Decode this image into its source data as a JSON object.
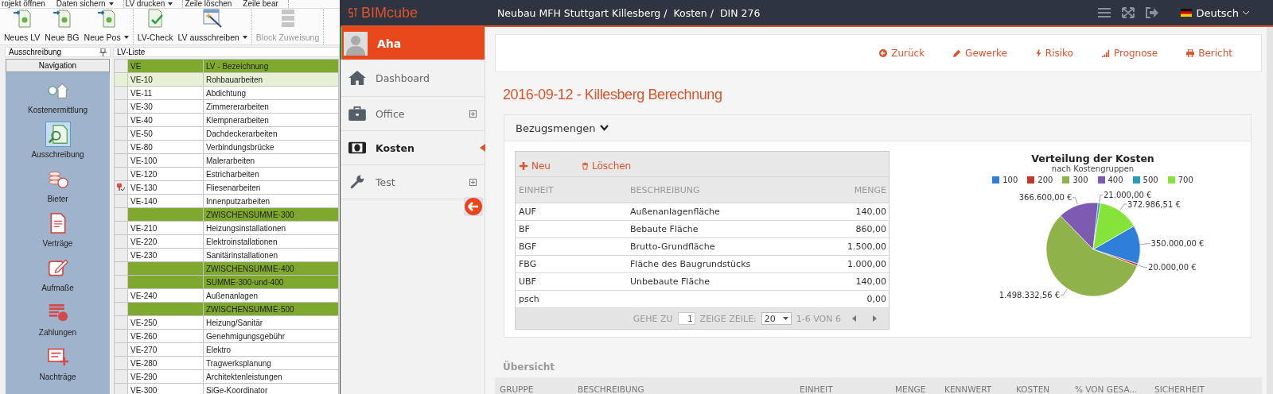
{
  "desktop_app": {
    "menu": [
      {
        "items": [
          {
            "label": "rojekt öffnen",
            "dropdown": false
          },
          {
            "label": "Daten sichern",
            "dropdown": true
          }
        ]
      },
      {
        "items": [
          {
            "label": "LV drucken",
            "dropdown": true
          }
        ]
      },
      {
        "items": [
          {
            "label": "Zeile löschen",
            "dropdown": false
          },
          {
            "label": "Zeile bear",
            "dropdown": false
          }
        ]
      }
    ],
    "toolbar": [
      {
        "buttons": [
          {
            "label": "Neues LV",
            "dropdown": false,
            "disabled": false
          },
          {
            "label": "Neue BG",
            "dropdown": false,
            "disabled": false
          },
          {
            "label": "Neue Pos",
            "dropdown": true,
            "disabled": false
          }
        ]
      },
      {
        "buttons": [
          {
            "label": "LV-Check",
            "dropdown": false,
            "disabled": false
          },
          {
            "label": "LV ausschreiben",
            "dropdown": true,
            "disabled": false
          }
        ]
      },
      {
        "buttons": [
          {
            "label": "Block Zuweisung",
            "dropdown": false,
            "disabled": true
          }
        ]
      }
    ],
    "nav_panel": {
      "title": "Ausschreibung",
      "header": "Navigation",
      "items": [
        {
          "label": "Kostenermittlung",
          "selected": false
        },
        {
          "label": "Ausschreibung",
          "selected": true
        },
        {
          "label": "Bieter",
          "selected": false
        },
        {
          "label": "Verträge",
          "selected": false
        },
        {
          "label": "Aufmaße",
          "selected": false
        },
        {
          "label": "Zahlungen",
          "selected": false
        },
        {
          "label": "Nachträge",
          "selected": false
        }
      ]
    },
    "lv_list": {
      "title": "LV-Liste",
      "columns": [
        "VE",
        "LV - Bezeichnung"
      ],
      "rows": [
        {
          "kind": "item",
          "ve": "VE-10",
          "name": "Rohbauarbeiten",
          "selected": true,
          "flagged": false
        },
        {
          "kind": "item",
          "ve": "VE-11",
          "name": "Abdichtung",
          "selected": false,
          "flagged": false
        },
        {
          "kind": "item",
          "ve": "VE-30",
          "name": "Zimmererarbeiten",
          "selected": false,
          "flagged": false
        },
        {
          "kind": "item",
          "ve": "VE-40",
          "name": "Klempnerarbeiten",
          "selected": false,
          "flagged": false
        },
        {
          "kind": "item",
          "ve": "VE-50",
          "name": "Dachdeckerarbeiten",
          "selected": false,
          "flagged": false
        },
        {
          "kind": "item",
          "ve": "VE-80",
          "name": "Verbindungsbrücke",
          "selected": false,
          "flagged": false
        },
        {
          "kind": "item",
          "ve": "VE-100",
          "name": "Malerarbeiten",
          "selected": false,
          "flagged": false
        },
        {
          "kind": "item",
          "ve": "VE-120",
          "name": "Estricharbeiten",
          "selected": false,
          "flagged": false
        },
        {
          "kind": "item",
          "ve": "VE-130",
          "name": "Fliesenarbeiten",
          "selected": false,
          "flagged": true
        },
        {
          "kind": "item",
          "ve": "VE-140",
          "name": "Innenputzarbeiten",
          "selected": false,
          "flagged": false
        },
        {
          "kind": "subtotal",
          "name": "ZWISCHENSUMME·300",
          "selected": false,
          "flagged": false
        },
        {
          "kind": "item",
          "ve": "VE-210",
          "name": "Heizungsinstallationen",
          "selected": false,
          "flagged": false
        },
        {
          "kind": "item",
          "ve": "VE-220",
          "name": "Elektroinstallationen",
          "selected": false,
          "flagged": false
        },
        {
          "kind": "item",
          "ve": "VE-230",
          "name": "Sanitärinstallationen",
          "selected": false,
          "flagged": false
        },
        {
          "kind": "subtotal",
          "name": "ZWISCHENSUMME·400",
          "selected": false,
          "flagged": false
        },
        {
          "kind": "subtotal",
          "name": "SUMME·300·und·400",
          "selected": false,
          "flagged": false
        },
        {
          "kind": "item",
          "ve": "VE-240",
          "name": "Außenanlagen",
          "selected": false,
          "flagged": false
        },
        {
          "kind": "subtotal",
          "name": "ZWISCHENSUMME·500",
          "selected": false,
          "flagged": false
        },
        {
          "kind": "item",
          "ve": "VE-250",
          "name": "Heizung/Sanitär",
          "selected": false,
          "flagged": false
        },
        {
          "kind": "item",
          "ve": "VE-260",
          "name": "Genehmigungsgebühr",
          "selected": false,
          "flagged": false
        },
        {
          "kind": "item",
          "ve": "VE-270",
          "name": "Elektro",
          "selected": false,
          "flagged": false
        },
        {
          "kind": "item",
          "ve": "VE-280",
          "name": "Tragwerksplanung",
          "selected": false,
          "flagged": false
        },
        {
          "kind": "item",
          "ve": "VE-290",
          "name": "Architektenleistungen",
          "selected": false,
          "flagged": false
        },
        {
          "kind": "item",
          "ve": "VE-300",
          "name": "SiGe-Koordinator",
          "selected": false,
          "flagged": false
        }
      ]
    }
  },
  "web_app": {
    "logo": "BIMcube",
    "breadcrumb": [
      "Neubau MFH Stuttgart Killesberg /",
      "Kosten /",
      "DIN 276"
    ],
    "language": "Deutsch",
    "user": {
      "name": "Aha"
    },
    "menu": [
      {
        "label": "Dashboard",
        "selected": false,
        "expandable": false
      },
      {
        "label": "Office",
        "selected": false,
        "expandable": true
      },
      {
        "label": "Kosten",
        "selected": true,
        "expandable": false
      },
      {
        "label": "Test",
        "selected": false,
        "expandable": true
      }
    ],
    "actions": [
      "Zurück",
      "Gewerke",
      "Risiko",
      "Prognose",
      "Bericht"
    ],
    "title": "2016-09-12 - Killesberg Berechnung",
    "panel": {
      "title": "Bezugsmengen",
      "expanded": true,
      "table": {
        "actions": [
          "Neu",
          "Löschen"
        ],
        "columns": [
          "EINHEIT",
          "BESCHREIBUNG",
          "MENGE"
        ],
        "rows": [
          {
            "einheit": "AUF",
            "beschreibung": "Außenanlagenfläche",
            "menge": "140,00"
          },
          {
            "einheit": "BF",
            "beschreibung": "Bebaute Fläche",
            "menge": "860,00"
          },
          {
            "einheit": "BGF",
            "beschreibung": "Brutto-Grundfläche",
            "menge": "1.500,00"
          },
          {
            "einheit": "FBG",
            "beschreibung": "Fläche des Baugrundstücks",
            "menge": "1.000,00"
          },
          {
            "einheit": "UBF",
            "beschreibung": "Unbebaute Fläche",
            "menge": "140,00"
          },
          {
            "einheit": "psch",
            "menge": "0,00"
          }
        ],
        "pager": {
          "goto_label": "GEHE ZU",
          "page": "1",
          "rows_label": "ZEIGE ZEILE:",
          "page_size": "20",
          "range": "1-6 VON 6"
        }
      },
      "chart": {
        "subtitle": "nach Kostengruppen",
        "chart_data": {
          "type": "pie",
          "title": "Verteilung der Kosten",
          "legend": true,
          "categories": [
            "100",
            "200",
            "300",
            "400",
            "500",
            "700"
          ],
          "colors": [
            "#2f7ed8",
            "#c0392b",
            "#8fb34a",
            "#7d5bb0",
            "#2a9bb8",
            "#86e33a"
          ],
          "values": [
            350000,
            20000,
            1498332.56,
            366600,
            21000,
            372986.51
          ],
          "value_labels": [
            "350.000,00 €",
            "20.000,00 €",
            "1.498.332,56 €",
            "366.600,00 €",
            "21.000,00 €",
            "372.986,51 €"
          ]
        }
      }
    },
    "overview": {
      "title": "Übersicht",
      "columns": [
        "GRUPPE",
        "BESCHREIBUNG",
        "EINHEIT",
        "MENGE",
        "KENNWERT",
        "KOSTEN",
        "% VON GESA...",
        "SICHERHEIT"
      ]
    }
  }
}
